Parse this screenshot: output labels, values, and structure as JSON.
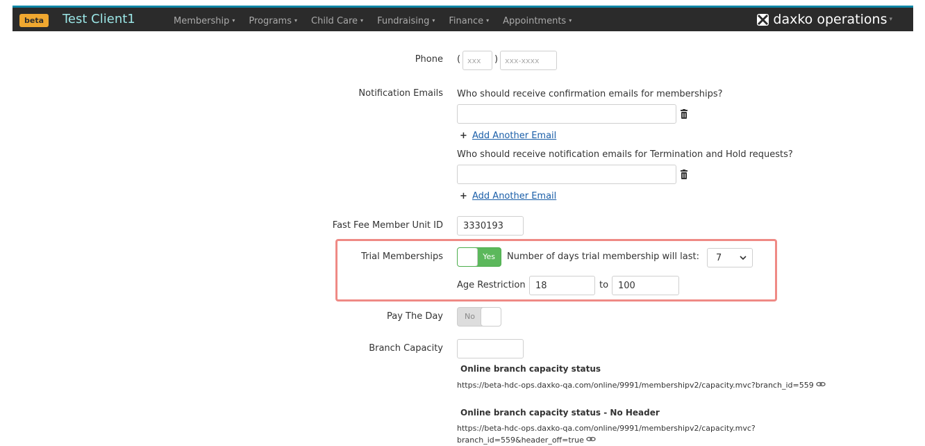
{
  "navbar": {
    "badge": "beta",
    "client_name": "Test Client1",
    "menu": [
      {
        "label": "Membership"
      },
      {
        "label": "Programs"
      },
      {
        "label": "Child Care"
      },
      {
        "label": "Fundraising"
      },
      {
        "label": "Finance"
      },
      {
        "label": "Appointments"
      }
    ],
    "product_name": "daxko operations",
    "caret": "▾"
  },
  "form": {
    "phone": {
      "label": "Phone",
      "area_code_placeholder": "xxx",
      "number_placeholder": "xxx-xxxx",
      "open_paren": "(",
      "close_paren": ")"
    },
    "notification_emails": {
      "label": "Notification Emails",
      "confirmation_question": "Who should receive confirmation emails for memberships?",
      "confirmation_value": "",
      "termination_question": "Who should receive notification emails for Termination and Hold requests?",
      "termination_value": "",
      "add_link": "Add Another Email",
      "plus": "+"
    },
    "fast_fee": {
      "label": "Fast Fee Member Unit ID",
      "value": "3330193"
    },
    "trial_memberships": {
      "label": "Trial Memberships",
      "toggle_label": "Yes",
      "toggle_on": true,
      "days_label": "Number of days trial membership will last:",
      "days_value": "7",
      "age_label": "Age Restriction",
      "age_min": "18",
      "to_label": "to",
      "age_max": "100"
    },
    "pay_the_day": {
      "label": "Pay The Day",
      "toggle_label": "No",
      "toggle_on": false
    },
    "branch_capacity": {
      "label": "Branch Capacity",
      "value": "",
      "status_title": "Online branch capacity status",
      "status_url": "https://beta-hdc-ops.daxko-qa.com/online/9991/membershipv2/capacity.mvc?branch_id=559",
      "no_header_title": "Online branch capacity status - No Header",
      "no_header_url_line1": "https://beta-hdc-ops.daxko-qa.com/online/9991/membershipv2/capacity.mvc?",
      "no_header_url_line2": "branch_id=559&header_off=true"
    }
  },
  "colors": {
    "navbar_bg": "#2b2b2b",
    "navbar_accent": "#0e86a6",
    "badge": "#f0a830",
    "brand_text": "#9be6e6",
    "toggle_on": "#5cb85c",
    "highlight": "#ef8a85",
    "link": "#1a5ea8"
  }
}
